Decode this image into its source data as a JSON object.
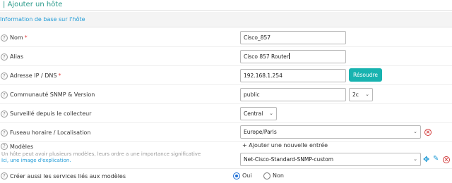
{
  "page": {
    "title": "Ajouter un hôte"
  },
  "section": {
    "title": "Information de base sur l'hôte"
  },
  "fields": {
    "name": {
      "label": "Nom",
      "required": "*",
      "value": "Cisco_857"
    },
    "alias": {
      "label": "Alias",
      "value": "Cisco 857 Router"
    },
    "address": {
      "label": "Adresse IP / DNS",
      "required": "*",
      "value": "192.168.1.254",
      "button": "Résoudre"
    },
    "snmp": {
      "label": "Communauté SNMP & Version",
      "community": "public",
      "version": "2c"
    },
    "monitored_from": {
      "label": "Surveillé depuis le collecteur",
      "value": "Central"
    },
    "timezone": {
      "label": "Fuseau horaire / Localisation",
      "value": "Europe/Paris"
    },
    "templates": {
      "label": "Modèles",
      "add_link": "+ Ajouter une nouvelle entrée",
      "description": "Un hôte peut avoir plusieurs modèles, leurs ordre a une importance significative",
      "description_link": "Ici, une image d'explication.",
      "value": "Net-Cisco-Standard-SNMP-custom"
    },
    "create_services": {
      "label": "Créer aussi les services liés aux modèles",
      "option_yes": "Oui",
      "option_no": "Non",
      "selected": "Oui"
    }
  },
  "icons": {
    "help": "question-circle-icon",
    "remove": "remove-circle-icon",
    "move": "move-arrows-icon",
    "edit": "pencil-icon",
    "chevron": "chevron-down-icon"
  },
  "colors": {
    "accent": "#18b3b0",
    "link": "#1e9ad6",
    "required": "#e43e3e",
    "remove": "#d23b3b"
  }
}
